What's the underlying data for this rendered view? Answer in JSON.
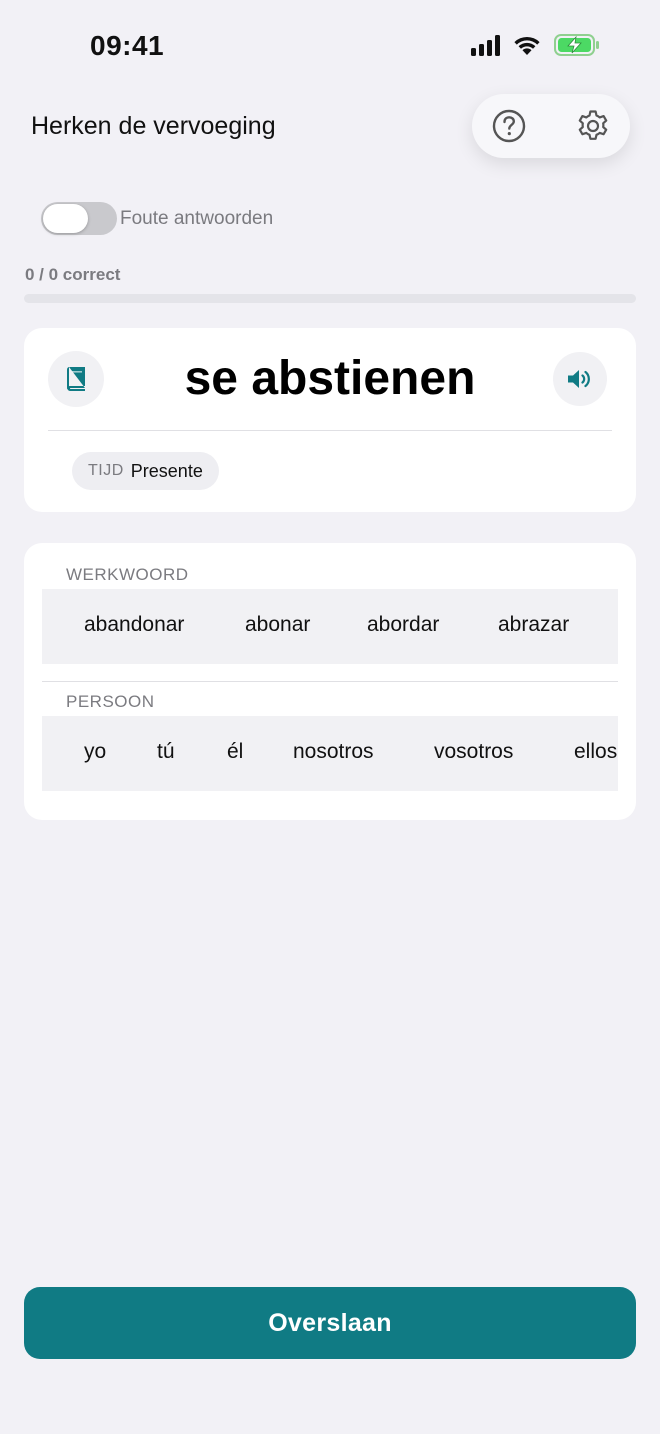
{
  "status_bar": {
    "time": "09:41"
  },
  "header": {
    "title": "Herken de vervoeging"
  },
  "toggle": {
    "label": "Foute antwoorden",
    "on": false
  },
  "progress": {
    "text": "0 / 0 correct",
    "fraction": 0
  },
  "verb_card": {
    "verb": "se abstienen",
    "tense_key": "TIJD",
    "tense_value": "Presente"
  },
  "picker": {
    "verb_label": "WERKWOORD",
    "verbs": [
      "abandonar",
      "abonar",
      "abordar",
      "abrazar"
    ],
    "person_label": "PERSOON",
    "persons": [
      "yo",
      "tú",
      "él",
      "nosotros",
      "vosotros",
      "ellos"
    ]
  },
  "skip_button": {
    "label": "Overslaan"
  },
  "colors": {
    "accent": "#107b84",
    "background": "#f2f1f6"
  }
}
